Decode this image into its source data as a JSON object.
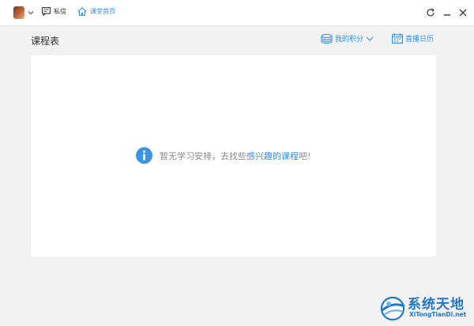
{
  "titlebar": {
    "messages_label": "私信",
    "home_label": "课堂首页"
  },
  "page": {
    "title": "课程表",
    "points_label": "我的积分",
    "calendar_label": "直播日历"
  },
  "empty_state": {
    "prefix": "暂无学习安排，去找些",
    "link": "感兴趣的课程",
    "suffix": "吧!"
  },
  "watermark": {
    "title": "系统天地",
    "url": "XiTongTianDi.net"
  },
  "colors": {
    "accent": "#2d8ff0",
    "background": "#f2f2f2",
    "card": "#ffffff"
  }
}
